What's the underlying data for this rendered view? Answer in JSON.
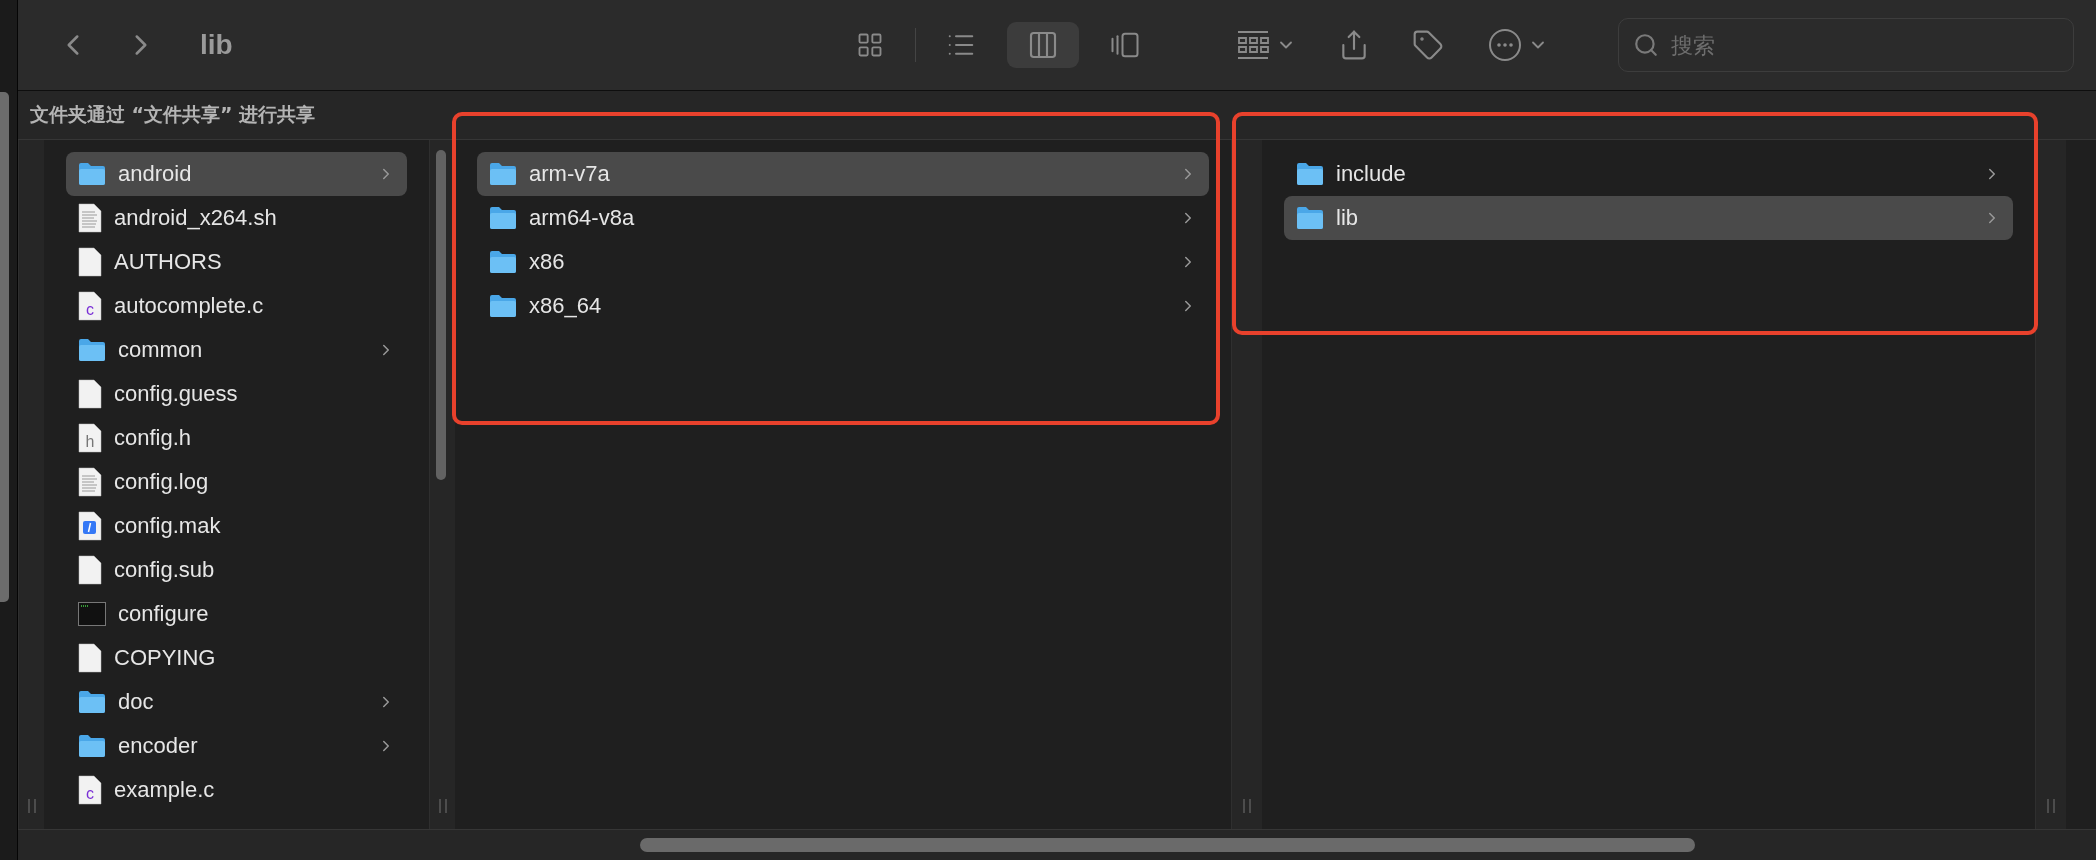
{
  "toolbar": {
    "title": "lib",
    "views": [
      {
        "kind": "icons",
        "selected": false
      },
      {
        "kind": "list",
        "selected": false
      },
      {
        "kind": "columns",
        "selected": true
      },
      {
        "kind": "gallery",
        "selected": false
      }
    ],
    "search": {
      "placeholder": "搜索"
    }
  },
  "share_bar": {
    "text": "文件夹通过 “文件共享” 进行共享"
  },
  "columns": [
    {
      "outlined": false,
      "items": [
        {
          "name": "android",
          "kind": "folder",
          "selected": true
        },
        {
          "name": "android_x264.sh",
          "kind": "text",
          "selected": false
        },
        {
          "name": "AUTHORS",
          "kind": "plain",
          "selected": false
        },
        {
          "name": "autocomplete.c",
          "kind": "source",
          "icon_label": "c",
          "selected": false
        },
        {
          "name": "common",
          "kind": "folder",
          "selected": false
        },
        {
          "name": "config.guess",
          "kind": "plain",
          "selected": false
        },
        {
          "name": "config.h",
          "kind": "header",
          "icon_label": "h",
          "selected": false
        },
        {
          "name": "config.log",
          "kind": "text",
          "selected": false
        },
        {
          "name": "config.mak",
          "kind": "make",
          "selected": false
        },
        {
          "name": "config.sub",
          "kind": "plain",
          "selected": false
        },
        {
          "name": "configure",
          "kind": "exec",
          "selected": false
        },
        {
          "name": "COPYING",
          "kind": "plain",
          "selected": false
        },
        {
          "name": "doc",
          "kind": "folder",
          "selected": false
        },
        {
          "name": "encoder",
          "kind": "folder",
          "selected": false
        },
        {
          "name": "example.c",
          "kind": "source",
          "icon_label": "c",
          "selected": false
        }
      ]
    },
    {
      "outlined": true,
      "items": [
        {
          "name": "arm-v7a",
          "kind": "folder",
          "selected": true
        },
        {
          "name": "arm64-v8a",
          "kind": "folder",
          "selected": false
        },
        {
          "name": "x86",
          "kind": "folder",
          "selected": false
        },
        {
          "name": "x86_64",
          "kind": "folder",
          "selected": false
        }
      ]
    },
    {
      "outlined": true,
      "items": [
        {
          "name": "include",
          "kind": "folder",
          "selected": false
        },
        {
          "name": "lib",
          "kind": "folder",
          "selected": true
        }
      ]
    }
  ]
}
